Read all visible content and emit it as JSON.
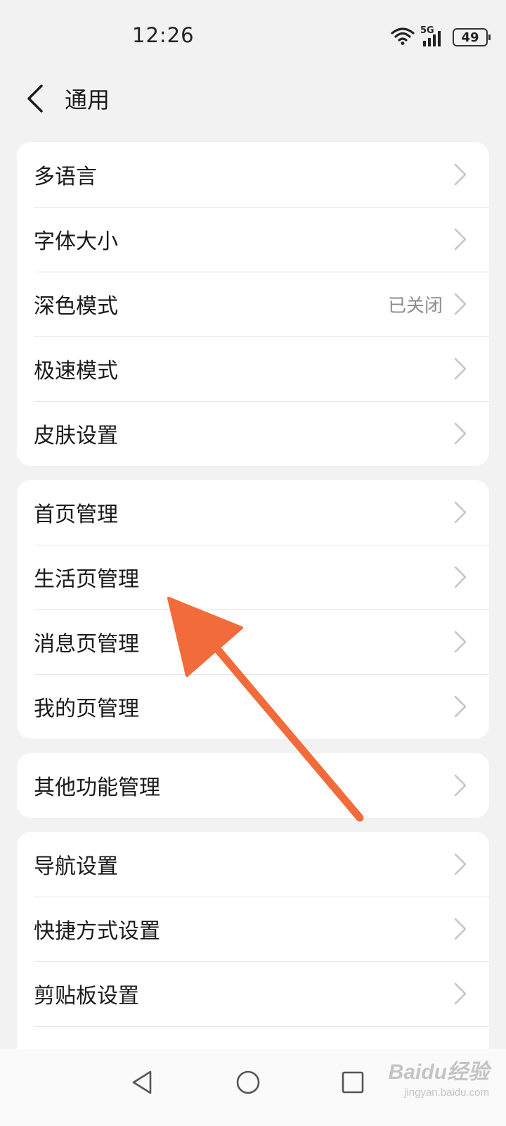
{
  "status_bar": {
    "time": "12:26",
    "network": "5G",
    "battery": "49"
  },
  "header": {
    "title": "通用",
    "back_icon": "chevron-left-icon"
  },
  "groups": [
    {
      "items": [
        {
          "label": "多语言",
          "value": ""
        },
        {
          "label": "字体大小",
          "value": ""
        },
        {
          "label": "深色模式",
          "value": "已关闭"
        },
        {
          "label": "极速模式",
          "value": ""
        },
        {
          "label": "皮肤设置",
          "value": ""
        }
      ]
    },
    {
      "items": [
        {
          "label": "首页管理",
          "value": ""
        },
        {
          "label": "生活页管理",
          "value": ""
        },
        {
          "label": "消息页管理",
          "value": ""
        },
        {
          "label": "我的页管理",
          "value": ""
        }
      ]
    },
    {
      "items": [
        {
          "label": "其他功能管理",
          "value": ""
        }
      ]
    },
    {
      "items": [
        {
          "label": "导航设置",
          "value": ""
        },
        {
          "label": "快捷方式设置",
          "value": ""
        },
        {
          "label": "剪贴板设置",
          "value": ""
        }
      ]
    }
  ],
  "nav_bar": {
    "back": "triangle-back-icon",
    "home": "circle-home-icon",
    "recents": "square-recents-icon"
  },
  "watermark": {
    "logo": "Baidu经验",
    "url": "jingyan.baidu.com"
  },
  "colors": {
    "background": "#f2f2f2",
    "card": "#ffffff",
    "annotation_arrow": "#f26b3a",
    "secondary_text": "#8c8c8c"
  }
}
